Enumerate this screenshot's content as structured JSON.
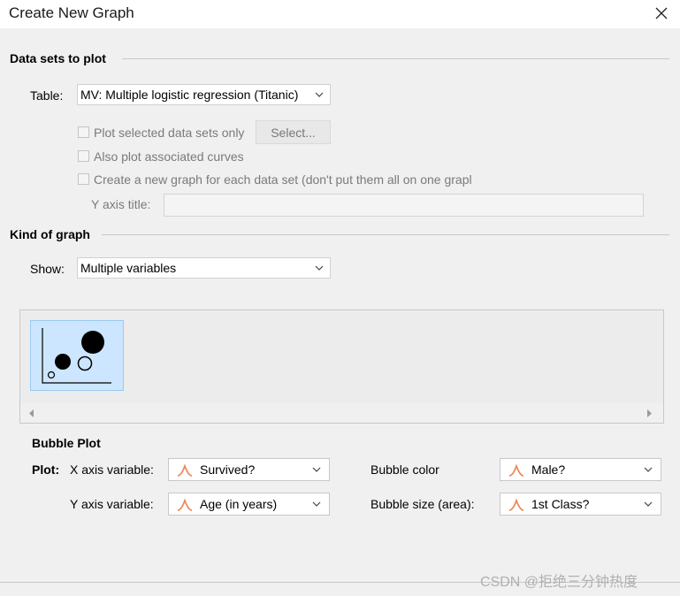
{
  "window": {
    "title": "Create New Graph"
  },
  "datasets": {
    "heading": "Data sets to plot",
    "table_label": "Table:",
    "table_value": "MV: Multiple logistic regression (Titanic)",
    "plot_selected_label": "Plot selected data sets only",
    "select_button": "Select...",
    "also_plot_label": "Also plot associated curves",
    "new_graph_label": "Create a new graph for each data set (don't put them all on one grapl",
    "yaxis_title_label": "Y axis title:"
  },
  "kind": {
    "heading": "Kind of graph",
    "show_label": "Show:",
    "show_value": "Multiple variables"
  },
  "bubble": {
    "heading": "Bubble Plot",
    "plot_label": "Plot:",
    "x_axis_label": "X axis variable:",
    "x_axis_value": "Survived?",
    "y_axis_label": "Y axis variable:",
    "y_axis_value": "Age (in years)",
    "color_label": "Bubble color",
    "color_value": "Male?",
    "size_label": "Bubble size (area):",
    "size_value": "1st Class?"
  },
  "watermark": "CSDN @拒绝三分钟热度",
  "icons": {
    "close": "close-icon",
    "dropdown": "chevron-down-icon",
    "distribution": "distribution-curve-icon",
    "bubble_thumb": "bubble-plot-icon"
  },
  "colors": {
    "accent_orange": "#e8895a",
    "selection_blue": "#cce6ff"
  }
}
